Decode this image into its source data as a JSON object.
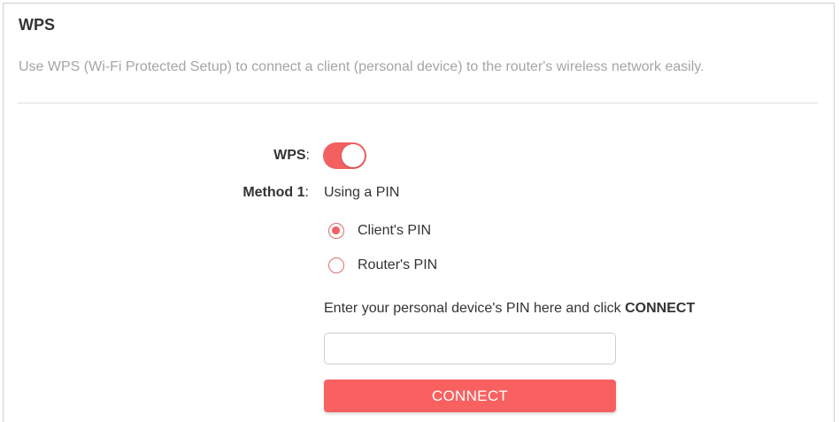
{
  "section": {
    "title": "WPS",
    "description": "Use WPS (Wi-Fi Protected Setup) to connect a client (personal device) to the router's wireless network easily."
  },
  "wps": {
    "label": "WPS",
    "colon": ":",
    "enabled": true,
    "toggle_color": "#f26060"
  },
  "method": {
    "label": "Method 1",
    "colon": ":",
    "value": "Using a PIN",
    "options": [
      {
        "label": "Client's PIN",
        "checked": true
      },
      {
        "label": "Router's PIN",
        "checked": false
      }
    ]
  },
  "pin": {
    "hint_prefix": "Enter your personal device's PIN here and click ",
    "hint_bold": "CONNECT",
    "value": "",
    "placeholder": ""
  },
  "connect_button": {
    "label": "CONNECT",
    "color": "#f96060"
  }
}
